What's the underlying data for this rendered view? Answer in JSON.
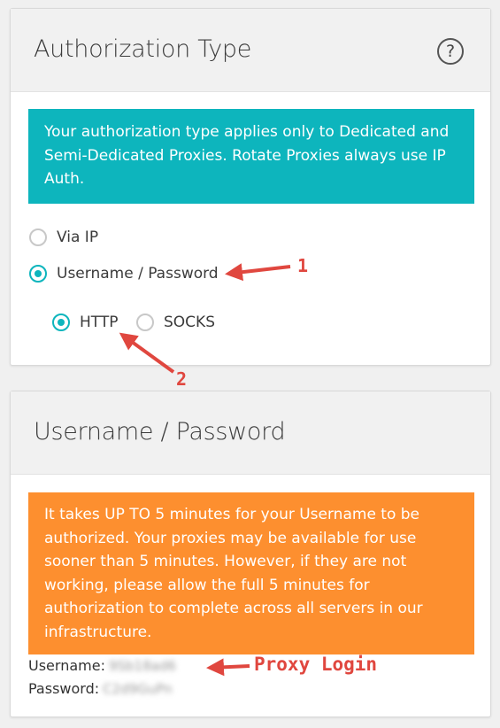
{
  "auth_card": {
    "title": "Authorization Type",
    "help_icon": "question-circle-icon",
    "notice": "Your authorization type applies only to Dedicated and Semi-Dedicated Proxies. Rotate Proxies always use IP Auth.",
    "options": [
      {
        "label": "Via IP",
        "checked": false
      },
      {
        "label": "Username / Password",
        "checked": true
      }
    ],
    "protocols": [
      {
        "label": "HTTP",
        "checked": true
      },
      {
        "label": "SOCKS",
        "checked": false
      }
    ]
  },
  "credentials_card": {
    "title": "Username / Password",
    "notice": "It takes UP TO 5 minutes for your Username to be authorized. Your proxies may be available for use sooner than 5 minutes. However, if they are not working, please allow the full 5 minutes for authorization to complete across all servers in our infrastructure.",
    "username_label": "Username:",
    "username_value": "9Sb18ad6",
    "password_label": "Password:",
    "password_value": "C2d9GuPn"
  },
  "annotations": {
    "marker_1": "1",
    "marker_2": "2",
    "proxy_login": "Proxy Login"
  },
  "colors": {
    "teal": "#0db5bd",
    "orange": "#fd8f2f",
    "annotation_red": "#e0473f"
  }
}
